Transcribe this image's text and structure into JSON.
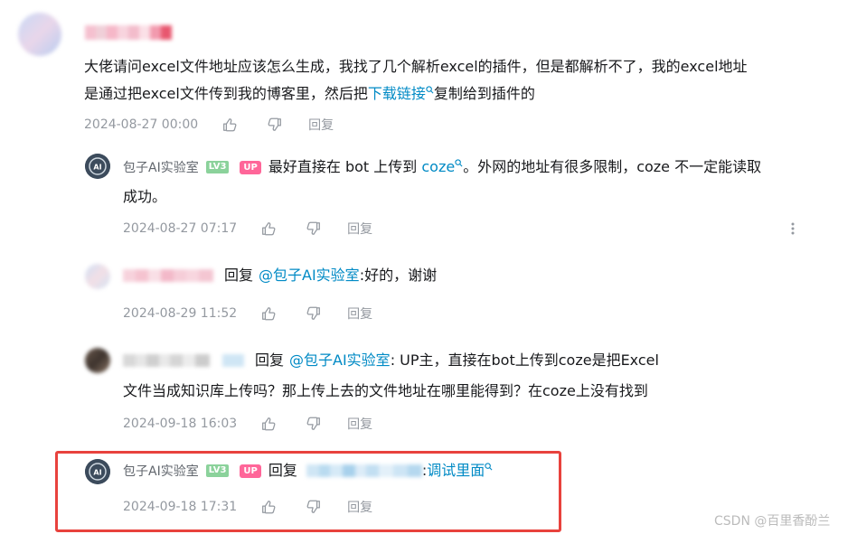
{
  "comment1": {
    "text_prefix": "大佬请问excel文件地址应该怎么生成，我找了几个解析excel的插件，但是都解析不了，我的excel地址",
    "text_line2_prefix": "是通过把excel文件传到我的博客里，然后把",
    "link_text": "下载链接",
    "text_line2_suffix": "复制给到插件的",
    "date": "2024-08-27 00:00",
    "reply_label": "回复"
  },
  "reply1": {
    "username": "包子AI实验室",
    "level_badge": "LV3",
    "up_badge": "UP",
    "text_prefix": "最好直接在 bot 上传到 ",
    "link_text": "coze",
    "text_suffix": "。外网的地址有很多限制，coze 不一定能读取",
    "text_line2": "成功。",
    "date": "2024-08-27 07:17",
    "reply_label": "回复"
  },
  "reply2": {
    "reply_word": "回复",
    "mention": "@包子AI实验室",
    "text": " :好的，谢谢",
    "date": "2024-08-29 11:52",
    "reply_label": "回复"
  },
  "reply3": {
    "reply_word": "回复",
    "mention": "@包子AI实验室",
    "text": " : UP主，直接在bot上传到coze是把Excel",
    "text_line2": "文件当成知识库上传吗？那上传上去的文件地址在哪里能得到？在coze上没有找到",
    "date": "2024-09-18 16:03",
    "reply_label": "回复"
  },
  "reply4": {
    "username": "包子AI实验室",
    "level_badge": "LV3",
    "up_badge": "UP",
    "reply_word": "回复",
    "colon": " :",
    "link_text": "调试里面",
    "date": "2024-09-18 17:31",
    "reply_label": "回复"
  },
  "watermark": "CSDN @百里香酚兰",
  "colors": {
    "link": "#008ac5",
    "meta": "#9499a0",
    "highlight": "#e8423d",
    "up_badge": "#ff6699",
    "lv_badge": "#8bd29b"
  }
}
